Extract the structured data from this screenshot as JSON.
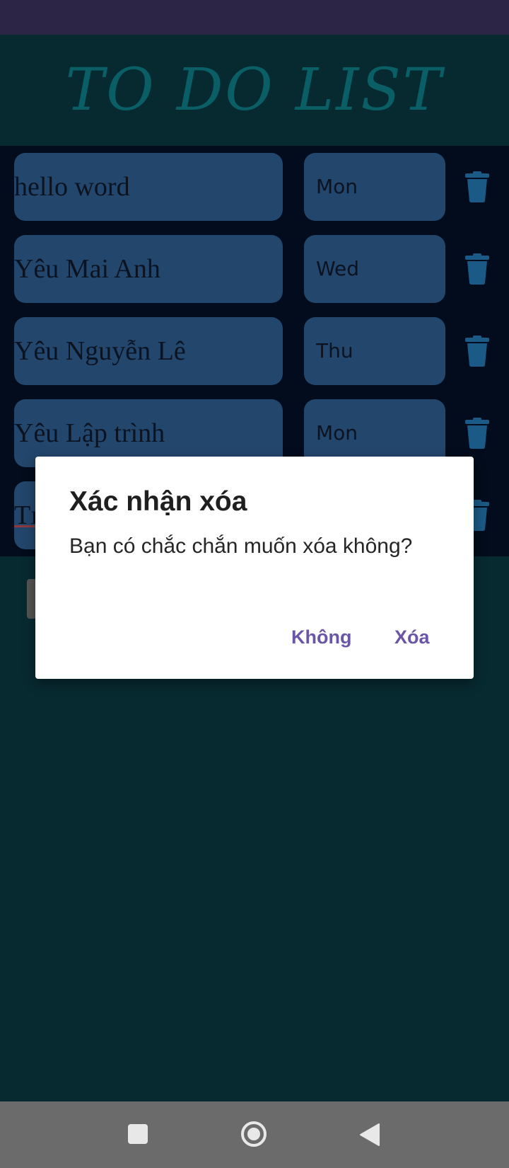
{
  "app": {
    "title": "TO DO LIST"
  },
  "tasks": [
    {
      "text": "hello word",
      "day": "Mon"
    },
    {
      "text": "Yêu Mai Anh",
      "day": "Wed"
    },
    {
      "text": "Yêu Nguyễn Lê",
      "day": "Thu"
    },
    {
      "text": "Yêu Lập trình",
      "day": "Mon"
    },
    {
      "text": "Tı",
      "day": ""
    }
  ],
  "icons": {
    "delete": "trash-icon",
    "nav_recents": "square-icon",
    "nav_home": "circle-icon",
    "nav_back": "triangle-back-icon"
  },
  "dialog": {
    "title": "Xác nhận xóa",
    "message": "Bạn có chắc chắn muốn xóa không?",
    "negative": "Không",
    "positive": "Xóa"
  },
  "colors": {
    "accent": "#6a55a6",
    "title": "#0a5f66",
    "item_bg": "#23466c",
    "trash": "#1b5a86"
  }
}
